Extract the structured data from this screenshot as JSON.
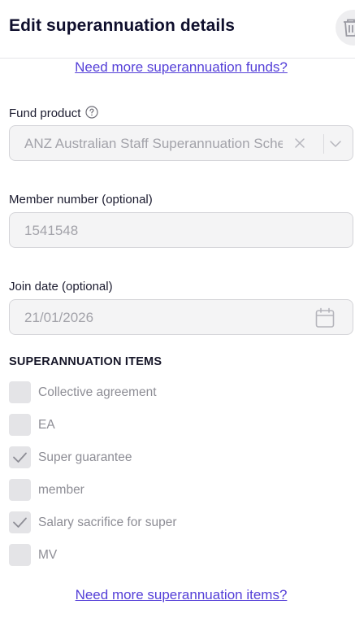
{
  "header": {
    "title": "Edit superannuation details",
    "delete_icon": "trash-icon"
  },
  "links": {
    "more_funds": "Need more superannuation funds?",
    "more_items": "Need more superannuation items?"
  },
  "fund_product": {
    "label": "Fund product",
    "help_icon": "question-circle-icon",
    "value": "ANZ Australian Staff Superannuation Scheme",
    "clear_icon": "close-icon",
    "dropdown_icon": "chevron-down-icon"
  },
  "member_number": {
    "label": "Member number (optional)",
    "value": "1541548"
  },
  "join_date": {
    "label": "Join date (optional)",
    "value": "21/01/2026",
    "icon": "calendar-icon"
  },
  "super_items": {
    "title": "SUPERANNUATION ITEMS",
    "items": [
      {
        "label": "Collective agreement",
        "checked": false
      },
      {
        "label": "EA",
        "checked": false
      },
      {
        "label": "Super guarantee",
        "checked": true
      },
      {
        "label": "member",
        "checked": false
      },
      {
        "label": "Salary sacrifice for super",
        "checked": true
      },
      {
        "label": "MV",
        "checked": false
      }
    ]
  },
  "colors": {
    "link": "#5540d8",
    "title": "#0f0f2d",
    "disabled_text": "#a3a3aa",
    "field_bg": "#f4f4f5",
    "checkbox_bg": "#e4e4e7"
  }
}
